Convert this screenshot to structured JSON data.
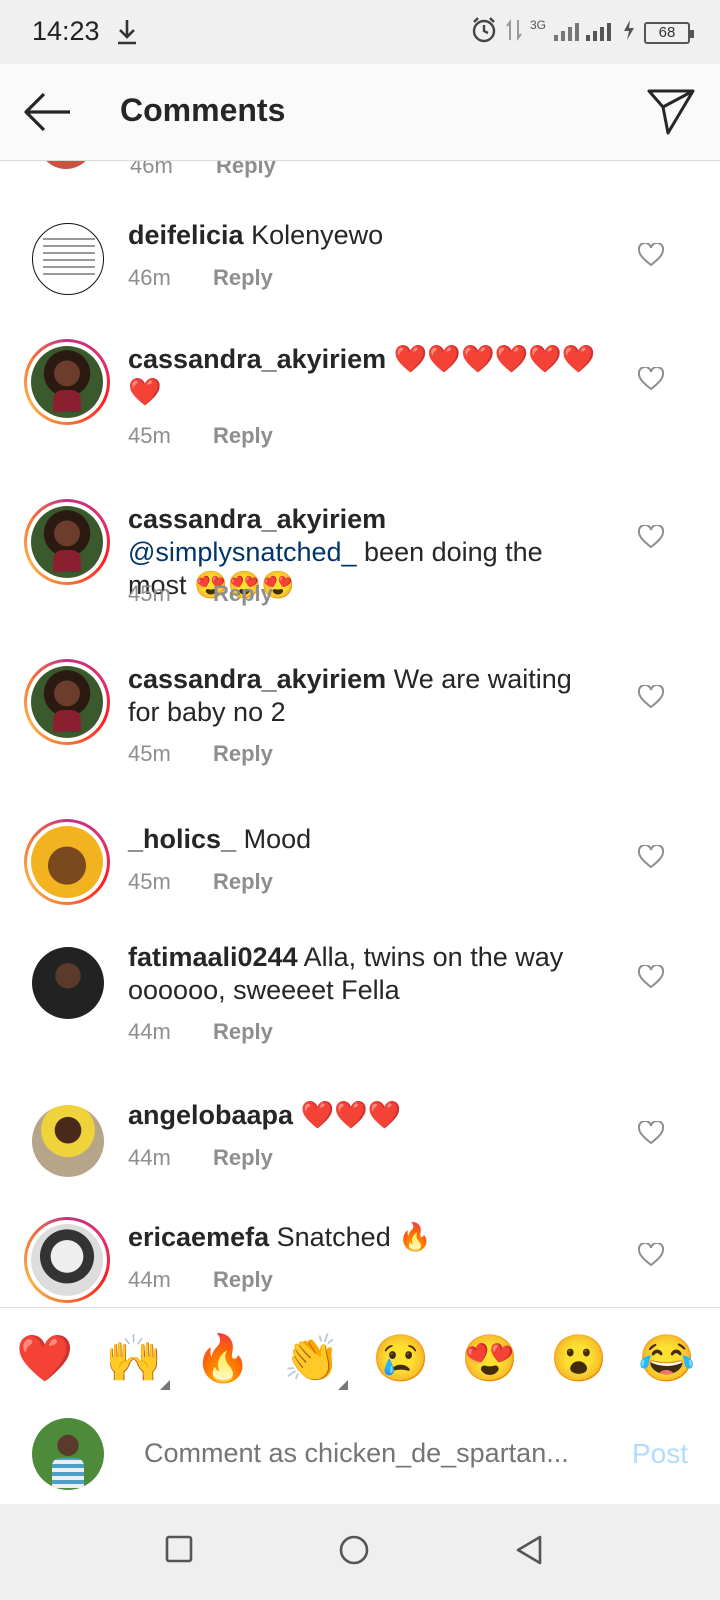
{
  "status_bar": {
    "time": "14:23",
    "network": "3G",
    "battery": "68",
    "icons": [
      "download-icon",
      "alarm-icon",
      "data-arrows-icon",
      "signal-icon",
      "charging-icon",
      "battery-icon"
    ]
  },
  "header": {
    "title": "Comments",
    "back_icon": "arrow-left-icon",
    "share_icon": "paper-plane-icon"
  },
  "partial_comment": {
    "time": "46m",
    "reply": "Reply"
  },
  "comments": [
    {
      "user": "deifelicia",
      "text": "Kolenyewo",
      "time": "46m",
      "reply": "Reply"
    },
    {
      "user": "cassandra_akyiriem",
      "text": "❤️❤️❤️❤️❤️❤️❤️",
      "time": "45m",
      "reply": "Reply"
    },
    {
      "user": "cassandra_akyiriem",
      "mention": "@simplysnatched_",
      "text": "been doing the most 😍😍😍",
      "time": "45m",
      "reply": "Reply"
    },
    {
      "user": "cassandra_akyiriem",
      "text": "We are waiting for baby no 2",
      "time": "45m",
      "reply": "Reply"
    },
    {
      "user": "_holics_",
      "text": "Mood",
      "time": "45m",
      "reply": "Reply"
    },
    {
      "user": "fatimaali0244",
      "text": "Alla, twins on the way oooooo, sweeeet Fella",
      "time": "44m",
      "reply": "Reply"
    },
    {
      "user": "angelobaapa",
      "text": "❤️❤️❤️",
      "time": "44m",
      "reply": "Reply"
    },
    {
      "user": "ericaemefa",
      "text": "Snatched 🔥",
      "time": "44m",
      "reply": "Reply"
    }
  ],
  "emoji_bar": [
    "❤️",
    "🙌",
    "🔥",
    "👏",
    "😢",
    "😍",
    "😮",
    "😂"
  ],
  "composer": {
    "placeholder": "Comment as chicken_de_spartan...",
    "post_label": "Post"
  },
  "nav_bar": {
    "icons": [
      "recents-square-icon",
      "home-circle-icon",
      "back-triangle-icon"
    ]
  }
}
